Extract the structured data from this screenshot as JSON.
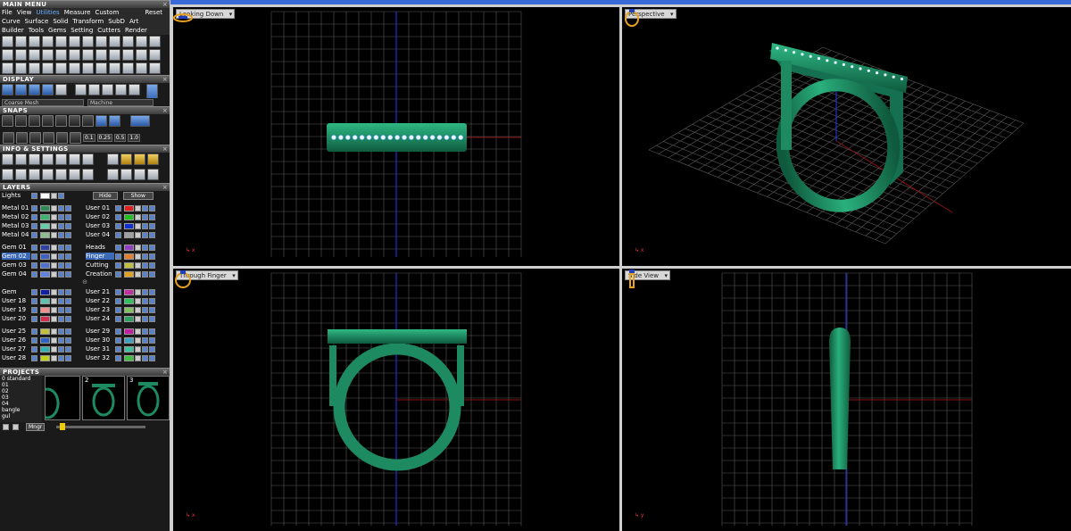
{
  "panels": {
    "main_menu": "MAIN MENU",
    "display": "DISPLAY",
    "snaps": "SNAPS",
    "info_settings": "INFO & SETTINGS",
    "layers": "LAYERS",
    "projects": "PROJECTS"
  },
  "menu": {
    "row1": [
      "File",
      "View",
      "Utilities",
      "Measure",
      "Custom"
    ],
    "reset": "Reset",
    "row2": [
      "Curve",
      "Surface",
      "Solid",
      "Transform",
      "SubD",
      "Art"
    ],
    "row3": [
      "Builder",
      "Tools",
      "Gems",
      "Setting",
      "Cutters",
      "Render"
    ]
  },
  "display": {
    "mode": "Coarse Mesh",
    "material": "Machine"
  },
  "snaps": {
    "values": [
      "0.1",
      "0.25",
      "0.5",
      "1.0"
    ]
  },
  "layers": {
    "lights": "Lights",
    "hide": "Hide",
    "show": "Show",
    "group1": [
      {
        "l": "Metal 01",
        "lc": "#2e8b57",
        "r": "User 01",
        "rc": "#e02020"
      },
      {
        "l": "Metal 02",
        "lc": "#3cb371",
        "r": "User 02",
        "rc": "#20c020"
      },
      {
        "l": "Metal 03",
        "lc": "#66cdaa",
        "r": "User 03",
        "rc": "#1030d0"
      },
      {
        "l": "Metal 04",
        "lc": "#8fbc8f",
        "r": "User 04",
        "rc": "#a0a0a0"
      }
    ],
    "group2": [
      {
        "l": "Gem 01",
        "lc": "#3040a0",
        "r": "Heads",
        "rc": "#9040c0"
      },
      {
        "l": "Gem 02",
        "lc": "#4060c0",
        "r": "Finger",
        "rc": "#e08030"
      },
      {
        "l": "Gem 03",
        "lc": "#5070d0",
        "r": "Cutting",
        "rc": "#c0c040"
      },
      {
        "l": "Gem 04",
        "lc": "#6080e0",
        "r": "Creation",
        "rc": "#e0a020"
      }
    ],
    "group3": [
      {
        "l": "Gem",
        "lc": "#1020a0",
        "r": "User 21",
        "rc": "#c030a0"
      },
      {
        "l": "User 18",
        "lc": "#60c0b0",
        "r": "User 22",
        "rc": "#30c060"
      },
      {
        "l": "User 19",
        "lc": "#f09090",
        "r": "User 23",
        "rc": "#80c060"
      },
      {
        "l": "User 20",
        "lc": "#d03050",
        "r": "User 24",
        "rc": "#30a060"
      }
    ],
    "group4": [
      {
        "l": "User 25",
        "lc": "#c0c040",
        "r": "User 29",
        "rc": "#c020a0"
      },
      {
        "l": "User 26",
        "lc": "#3060c0",
        "r": "User 30",
        "rc": "#40a0c0"
      },
      {
        "l": "User 27",
        "lc": "#30b0b0",
        "r": "User 31",
        "rc": "#40c0a0"
      },
      {
        "l": "User 28",
        "lc": "#c0d020",
        "r": "User 32",
        "rc": "#40c040"
      }
    ]
  },
  "projects": {
    "list": [
      "0 standard",
      "01",
      "02",
      "03",
      "04",
      "bangle",
      "gul"
    ],
    "thumbs": [
      "",
      "2",
      "3"
    ],
    "manager_btn": "Mngr"
  },
  "viewports": {
    "tl": "Looking Down",
    "tr": "Perspective",
    "bl": "Through Finger",
    "br": "Side View"
  },
  "colors": {
    "ring": "#1e8a62",
    "ring_light": "#2ab07c",
    "grid": "#5a5a5a",
    "axis_blue": "#2030d0",
    "axis_red": "#8a1010"
  }
}
